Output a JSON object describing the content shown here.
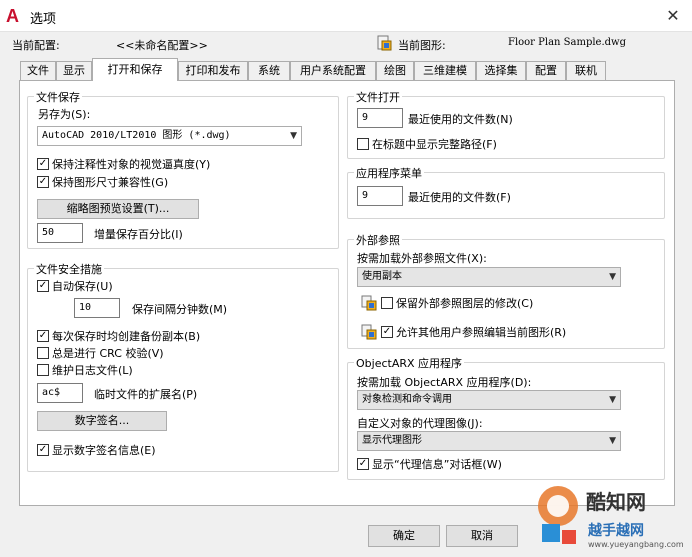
{
  "window": {
    "title": "选项",
    "close_glyph": "✕"
  },
  "profile": {
    "current_profile_label": "当前配置:",
    "current_profile_value": "<<未命名配置>>",
    "current_drawing_label": "当前图形:",
    "current_drawing_value": "Floor Plan Sample.dwg"
  },
  "tabs": [
    "文件",
    "显示",
    "打开和保存",
    "打印和发布",
    "系统",
    "用户系统配置",
    "绘图",
    "三维建模",
    "选择集",
    "配置",
    "联机"
  ],
  "file_save": {
    "title": "文件保存",
    "save_as_label": "另存为(S):",
    "save_as_value": "AutoCAD 2010/LT2010 图形 (*.dwg)",
    "keep_annotative": "保持注释性对象的视觉逼真度(Y)",
    "keep_drawing_size": "保持图形尺寸兼容性(G)",
    "thumbnail_button": "缩略图预览设置(T)...",
    "incremental_value": "50",
    "incremental_label": "增量保存百分比(I)"
  },
  "file_safety": {
    "title": "文件安全措施",
    "autosave": "自动保存(U)",
    "autosave_minutes": "10",
    "autosave_minutes_label": "保存间隔分钟数(M)",
    "backup_copy": "每次保存时均创建备份副本(B)",
    "crc_check": "总是进行 CRC 校验(V)",
    "log_file": "维护日志文件(L)",
    "temp_ext_value": "ac$",
    "temp_ext_label": "临时文件的扩展名(P)",
    "digital_sign_button": "数字签名...",
    "show_sign_info": "显示数字签名信息(E)"
  },
  "file_open": {
    "title": "文件打开",
    "recent_count": "9",
    "recent_label": "最近使用的文件数(N)",
    "full_path": "在标题中显示完整路径(F)"
  },
  "app_menu": {
    "title": "应用程序菜单",
    "recent_count": "9",
    "recent_label": "最近使用的文件数(F)"
  },
  "xref": {
    "title": "外部参照",
    "demand_load_label": "按需加载外部参照文件(X):",
    "demand_load_value": "使用副本",
    "retain_changes": "保留外部参照图层的修改(C)",
    "allow_edit": "允许其他用户参照编辑当前图形(R)"
  },
  "objectarx": {
    "title": "ObjectARX 应用程序",
    "demand_load_label": "按需加载 ObjectARX 应用程序(D):",
    "demand_load_value": "对象检测和命令调用",
    "proxy_images_label": "自定义对象的代理图像(J):",
    "proxy_images_value": "显示代理图形",
    "show_proxy_dialog": "显示“代理信息”对话框(W)"
  },
  "buttons": {
    "ok": "确定",
    "cancel": "取消"
  },
  "watermark": {
    "brand": "酷知网",
    "tag": "越手越网",
    "url": "www.yueyangbang.com"
  },
  "colors": {
    "accent_red": "#c8102e",
    "panel_border": "#adadad",
    "button_bg": "#e1e1e1"
  }
}
